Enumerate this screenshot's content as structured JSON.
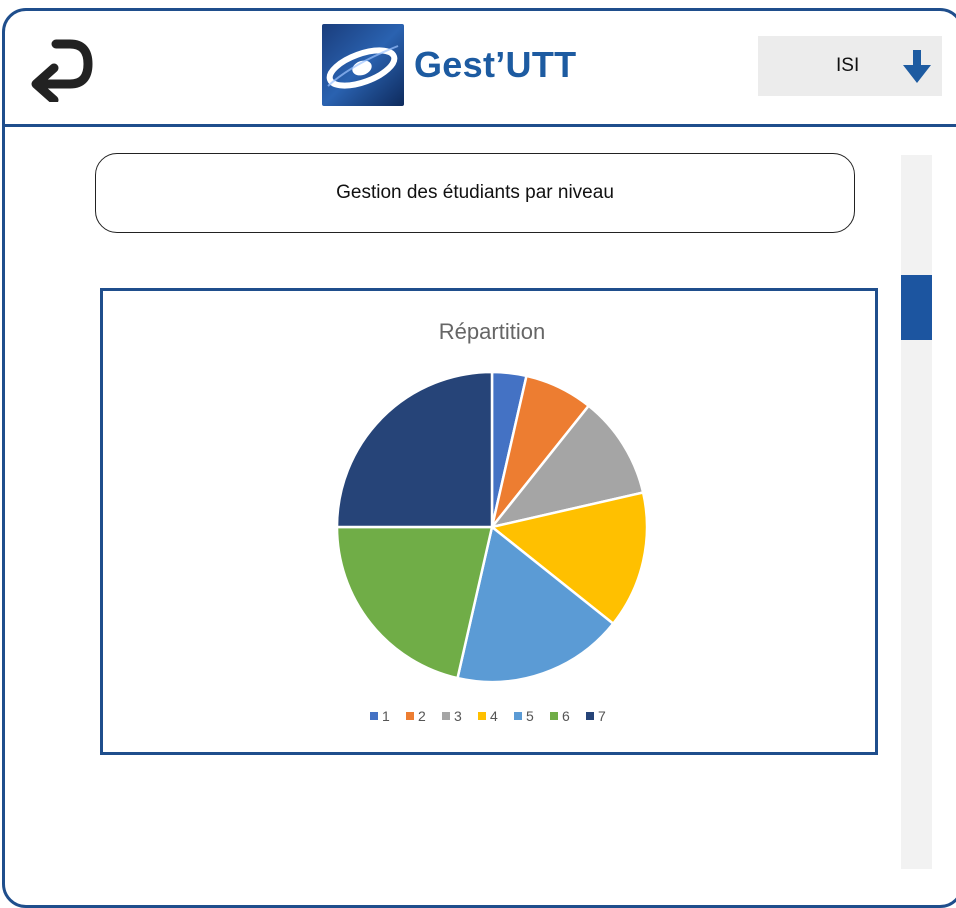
{
  "header": {
    "back_icon": "return-arrow-icon",
    "logo_icon": "gestutt-logo",
    "brand_name": "Gest’UTT",
    "program_select": {
      "value": "ISI",
      "icon": "arrow-down-icon"
    }
  },
  "main": {
    "section_title": "Gestion des étudiants par niveau"
  },
  "colors": {
    "frame": "#1f4e8c",
    "brand": "#1d5ba1",
    "scroll_thumb": "#1c55a0"
  },
  "chart_data": {
    "type": "pie",
    "title": "Répartition",
    "categories": [
      "1",
      "2",
      "3",
      "4",
      "5",
      "6",
      "7"
    ],
    "values": [
      1,
      2,
      3,
      4,
      5,
      6,
      7
    ],
    "colors": [
      "#4472c4",
      "#ed7d31",
      "#a5a5a5",
      "#ffc000",
      "#5b9bd5",
      "#70ad47",
      "#264478"
    ],
    "legend": "bottom"
  },
  "scrollbar": {
    "icon": "vertical-scrollbar"
  }
}
